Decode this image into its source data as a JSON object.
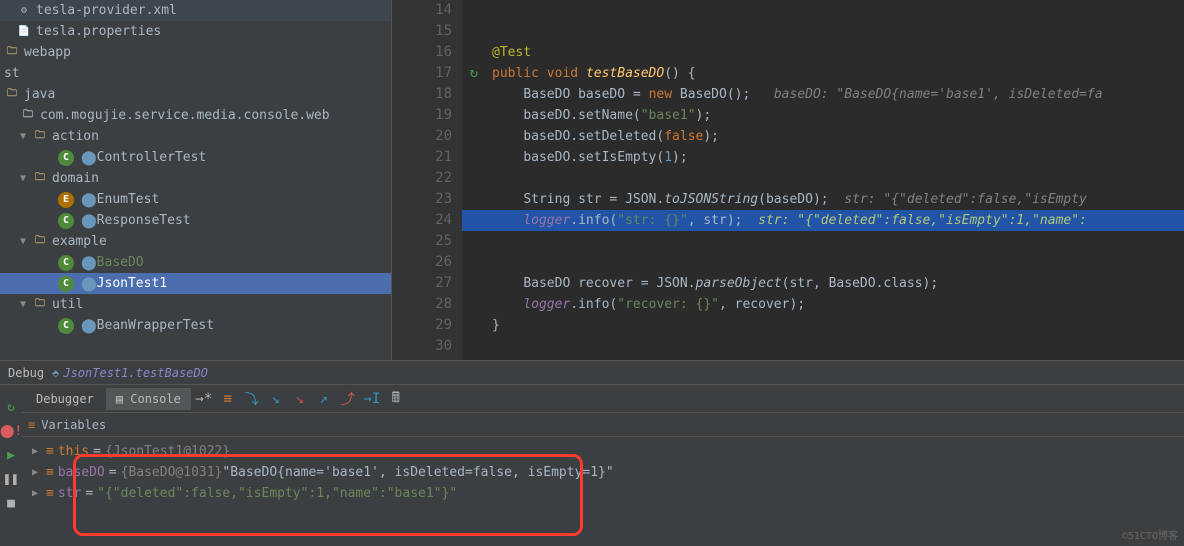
{
  "tree": {
    "f0": "tesla-provider.xml",
    "f1": "tesla.properties",
    "f2": "webapp",
    "f3": "st",
    "f4": "java",
    "f5": "com.mogujie.service.media.console.web",
    "f6": "action",
    "f7": "ControllerTest",
    "f8": "domain",
    "f9": "EnumTest",
    "f10": "ResponseTest",
    "f11": "example",
    "f12": "BaseDO",
    "f13": "JsonTest1",
    "f14": "util",
    "f15": "BeanWrapperTest"
  },
  "lines": [
    "14",
    "15",
    "16",
    "17",
    "18",
    "19",
    "20",
    "21",
    "22",
    "23",
    "24",
    "25",
    "26",
    "27",
    "28",
    "29",
    "30"
  ],
  "code": {
    "ann": "@Test",
    "kw_public": "public",
    "kw_void": "void",
    "kw_new": "new",
    "kw_false": "false",
    "m_name": "testBaseDO",
    "cls_BaseDO": "BaseDO",
    "cls_JSON": "JSON",
    "cls_String": "String",
    "v_baseDO": "baseDO",
    "v_str": "str",
    "v_recover": "recover",
    "v_logger": "logger",
    "m_setName": "setName",
    "m_setDeleted": "setDeleted",
    "m_setIsEmpty": "setIsEmpty",
    "m_toJSONString": "toJSONString",
    "m_parseObject": "parseObject",
    "m_info": "info",
    "s_base1": "\"base1\"",
    "n_1": "1",
    "s_strfmt": "\"str: {}\"",
    "s_recfmt": "\"recover: {}\"",
    "hint1": "baseDO: \"BaseDO{name='base1', isDeleted=fa",
    "hint2": "str: \"{\"deleted\":false,\"isEmpty",
    "hint3": "str: \"{\"deleted\":false,\"isEmpty\":1,\"name\":",
    "dotclass": ".class"
  },
  "debug": {
    "label": "Debug",
    "run": "JsonTest1.testBaseDO",
    "tab_dbg": "Debugger",
    "tab_con": "Console",
    "vars_label": "Variables",
    "var_this": "this",
    "var_this_val": "{JsonTest1@1022}",
    "var_baseDO": "baseDO",
    "var_baseDO_type": "{BaseDO@1031}",
    "var_baseDO_val": " \"BaseDO{name='base1', isDeleted=false, isEmpty=1}\"",
    "var_str": "str",
    "var_str_val": "\"{\"deleted\":false,\"isEmpty\":1,\"name\":\"base1\"}\""
  },
  "watermark": "©51CTO博客"
}
